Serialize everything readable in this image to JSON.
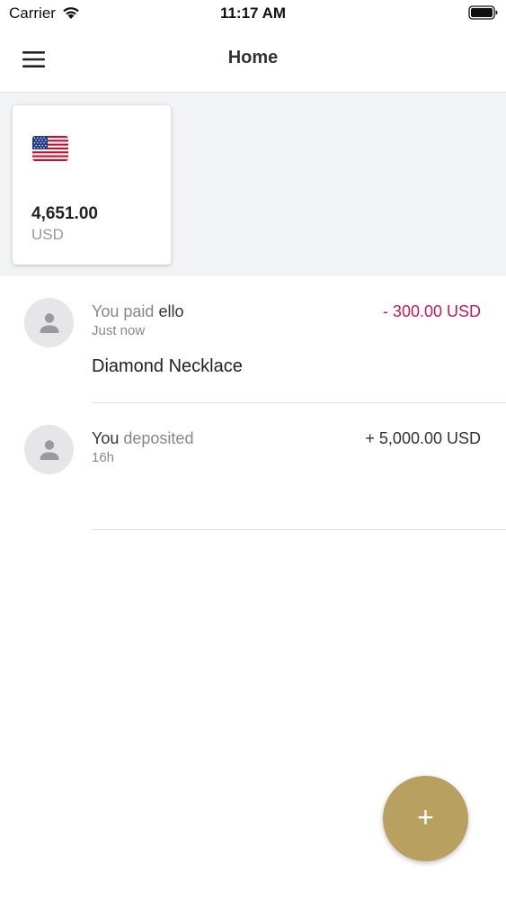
{
  "status_bar": {
    "carrier": "Carrier",
    "time": "11:17 AM",
    "wifi_icon": "wifi-icon",
    "battery_icon": "battery-icon"
  },
  "nav": {
    "title": "Home",
    "menu_icon": "hamburger-menu-icon"
  },
  "wallet": {
    "flag_icon": "us-flag-icon",
    "balance": "4,651.00",
    "currency": "USD"
  },
  "transactions": [
    {
      "prefix": "You paid",
      "party": "ello",
      "time": "Just now",
      "amount": "- 300.00 USD",
      "amount_color": "#c3195d",
      "note": "Diamond Necklace",
      "avatar_icon": "person-icon"
    },
    {
      "prefix": "You",
      "party": "deposited",
      "time": "16h",
      "amount": "+ 5,000.00 USD",
      "amount_color": "#333333",
      "note": "",
      "avatar_icon": "person-icon"
    }
  ],
  "fab": {
    "label": "+",
    "color": "#b8a060"
  }
}
